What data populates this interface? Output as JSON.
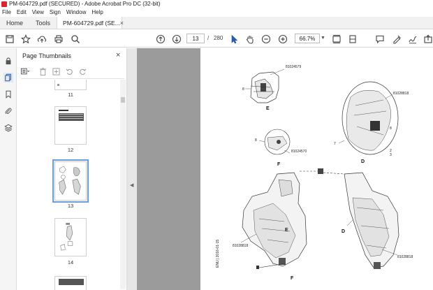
{
  "window": {
    "title": "PM-604729.pdf (SECURED) - Adobe Acrobat Pro DC (32-bit)"
  },
  "menu": [
    "File",
    "Edit",
    "View",
    "Sign",
    "Window",
    "Help"
  ],
  "tabs": {
    "home": "Home",
    "tools": "Tools",
    "document": "PM-604729.pdf (SE...",
    "close_glyph": "×"
  },
  "toolbar": {
    "current_page": "13",
    "page_separator": "/",
    "total_pages": "280",
    "zoom": "66.7%",
    "icons": [
      "save-icon",
      "bookmark-star-icon",
      "upload-icon",
      "print-icon",
      "find-icon",
      "prev-page-icon",
      "next-page-icon",
      "select-cursor-icon",
      "hand-icon",
      "zoom-out-icon",
      "zoom-in-icon",
      "page-fit-icon",
      "scroll-mode-icon",
      "comment-icon",
      "highlight-icon",
      "sign-icon",
      "share-icon"
    ]
  },
  "panel": {
    "title": "Page Thumbnails",
    "close_glyph": "×",
    "thumbnails": [
      {
        "label": "11"
      },
      {
        "label": "12"
      },
      {
        "label": "13"
      },
      {
        "label": "14"
      }
    ]
  },
  "page_content": {
    "callouts": {
      "top_center": "81024579",
      "right_top": "81028818",
      "middle_left": "81024570",
      "bottom_left": "81028818",
      "bottom_right": "81028818",
      "vertical_footer": "ENU | 2016-01-15"
    },
    "view_letters": {
      "e_top": "E",
      "d_right": "D",
      "f_mid": "F",
      "d_bottom": "D",
      "e_bottom": "E",
      "f_bottom": "F"
    },
    "small_numbers": {
      "n8a": "8",
      "n8b": "8",
      "n8c": "8",
      "n7": "7",
      "n2": "2",
      "n3": "3"
    }
  }
}
